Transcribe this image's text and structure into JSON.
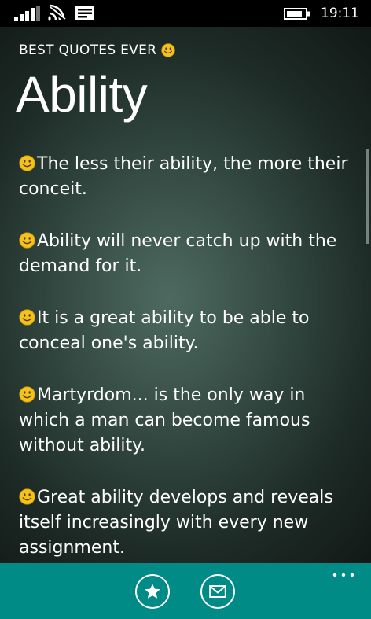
{
  "status_bar": {
    "time": "19:11",
    "icons": [
      "signal-icon",
      "wifi-icon",
      "message-icon",
      "battery-icon"
    ]
  },
  "header": {
    "app_title": "BEST QUOTES EVER",
    "page_title": "Ability"
  },
  "quotes": [
    {
      "text": "The less their ability, the more their conceit."
    },
    {
      "text": "Ability will never catch up with the demand for it."
    },
    {
      "text": "It is a great ability to be able to conceal one's ability."
    },
    {
      "text": "Martyrdom... is the only way in which a man can become famous without ability."
    },
    {
      "text": "Great ability develops and reveals itself increasingly with every new assignment."
    }
  ],
  "app_bar": {
    "buttons": [
      "star-icon",
      "mail-icon",
      "more-icon"
    ]
  },
  "colors": {
    "accent": "#008b87",
    "smiley": "#f3c21b",
    "text": "#ffffff",
    "status_bar": "#000000"
  }
}
